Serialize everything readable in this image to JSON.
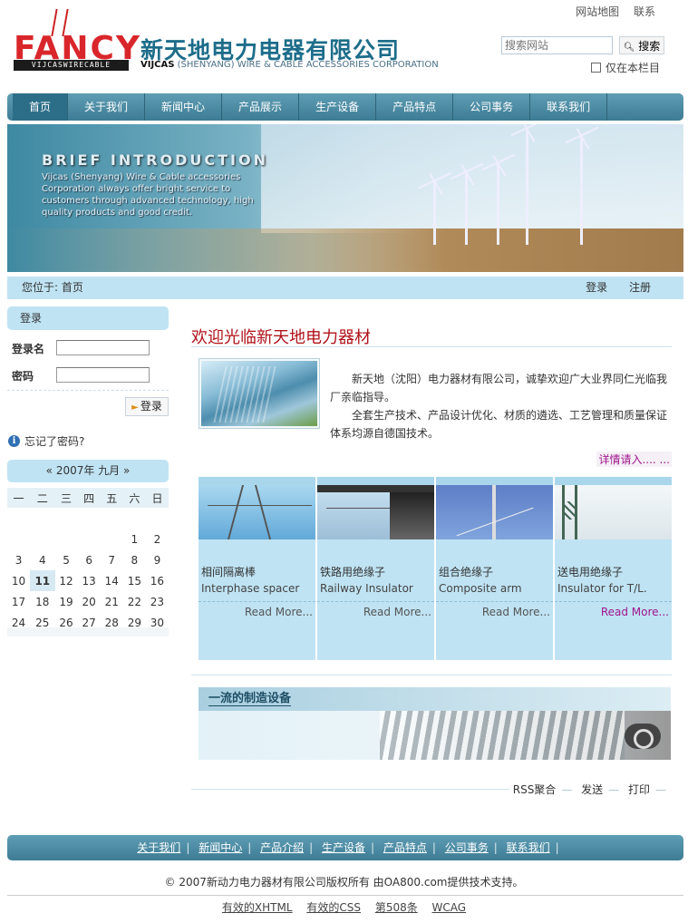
{
  "top_links": {
    "sitemap": "网站地图",
    "contact": "联系"
  },
  "logo": {
    "word": "FANCY",
    "strip": "VIJCASWIRECABLE"
  },
  "company": {
    "cn": "新天地电力电器有限公司",
    "en_bold": "VIJCAS",
    "en_rest": " (SHENYANG) WIRE & CABLE ACCESSORIES CORPORATION"
  },
  "search": {
    "placeholder": "搜索网站",
    "button": "搜索",
    "only_this_column": "仅在本栏目"
  },
  "nav": [
    "首页",
    "关于我们",
    "新闻中心",
    "产品展示",
    "生产设备",
    "产品特点",
    "公司事务",
    "联系我们"
  ],
  "banner": {
    "title": "BRIEF INTRODUCTION",
    "text": "Vijcas (Shenyang) Wire & Cable accessories Corporation always offer bright service to customers through advanced technology, high quality products and good credit."
  },
  "location": {
    "label": "您位于:",
    "current": "首页",
    "login": "登录",
    "register": "注册"
  },
  "login": {
    "title": "登录",
    "username_label": "登录名",
    "password_label": "密码",
    "submit": "登录",
    "forgot": "忘记了密码?"
  },
  "calendar": {
    "prev": "«",
    "title": "2007年 九月",
    "next": "»",
    "weekdays": [
      "一",
      "二",
      "三",
      "四",
      "五",
      "六",
      "日"
    ],
    "weeks": [
      [
        "",
        "",
        "",
        "",
        "",
        "",
        ""
      ],
      [
        "",
        "",
        "",
        "",
        "",
        "1",
        "2"
      ],
      [
        "3",
        "4",
        "5",
        "6",
        "7",
        "8",
        "9"
      ],
      [
        "10",
        "11",
        "12",
        "13",
        "14",
        "15",
        "16"
      ],
      [
        "17",
        "18",
        "19",
        "20",
        "21",
        "22",
        "23"
      ],
      [
        "24",
        "25",
        "26",
        "27",
        "28",
        "29",
        "30"
      ]
    ],
    "today": "11"
  },
  "welcome": {
    "title": "欢迎光临新天地电力器材",
    "p1": "新天地（沈阳）电力器材有限公司，诚挚欢迎广大业界同仁光临我厂亲临指导。",
    "p2": "全套生产技术、产品设计优化、材质的遴选、工艺管理和质量保证体系均源自德国技术。",
    "more": "详情请入.... ..."
  },
  "products": [
    {
      "cn": "相间隔离棒",
      "en": "Interphase spacer",
      "more": "Read More..."
    },
    {
      "cn": "铁路用绝缘子",
      "en": "Railway Insulator",
      "more": "Read More..."
    },
    {
      "cn": "组合绝缘子",
      "en": "Composite arm",
      "more": "Read More..."
    },
    {
      "cn": "送电用绝缘子",
      "en": "Insulator for T/L.",
      "more": "Read More..."
    }
  ],
  "equipment": {
    "title": "一流的制造设备"
  },
  "actions": {
    "rss": "RSS聚合",
    "send": "发送",
    "print": "打印"
  },
  "footer_nav": [
    "关于我们",
    "新闻中心",
    "产品介绍",
    "生产设备",
    "产品特点",
    "公司事务",
    "联系我们"
  ],
  "copyright": "© 2007新动力电力器材有限公司版权所有 由OA800.com提供技术支持。",
  "validation": [
    "有效的XHTML",
    "有效的CSS",
    "第508条",
    "WCAG"
  ]
}
